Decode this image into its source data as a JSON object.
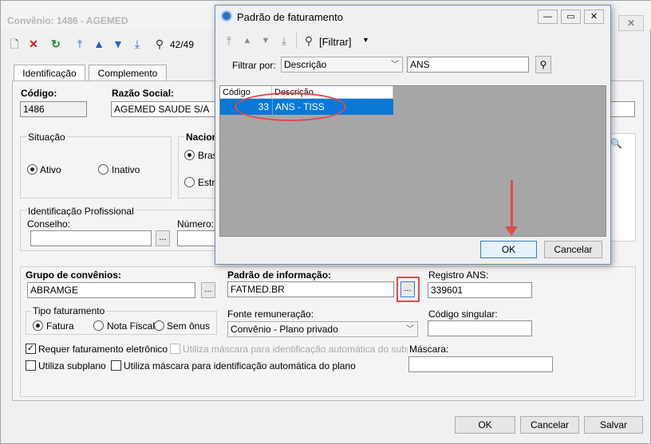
{
  "main_window": {
    "title": "Convênio: 1486 - AGEMED",
    "close_label": "✕",
    "record_counter": "42/49",
    "tabs": [
      "Identificação",
      "Complemento"
    ],
    "codigo": {
      "label": "Código:",
      "value": "1486"
    },
    "razao_social": {
      "label": "Razão Social:",
      "value": "AGEMED SAUDE S/A"
    },
    "situacao": {
      "label": "Situação",
      "options": [
        "Ativo",
        "Inativo"
      ],
      "selected": "Ativo"
    },
    "nacionalidade": {
      "label": "Nacion",
      "options": [
        "Bras",
        "Estra"
      ]
    },
    "id_profissional": {
      "label": "Identificação Profissional",
      "conselho_label": "Conselho:",
      "numero_label": "Número:"
    },
    "grupo_convenios": {
      "label": "Grupo de convênios:",
      "value": "ABRAMGE"
    },
    "padrao_informacao": {
      "label": "Padrão de informação:",
      "value": "FATMED.BR"
    },
    "registro_ans": {
      "label": "Registro ANS:",
      "value": "339601"
    },
    "tipo_faturamento": {
      "label": "Tipo faturamento",
      "options": [
        "Fatura",
        "Nota Fiscal",
        "Sem ônus"
      ],
      "selected": "Fatura"
    },
    "fonte_remuneracao": {
      "label": "Fonte remuneração:",
      "value": "Convênio - Plano privado"
    },
    "codigo_singular": {
      "label": "Código singular:"
    },
    "mascara": {
      "label": "Máscara:"
    },
    "checks": {
      "requer": "Requer faturamento eletrônico",
      "mascara_subplano": "Utiliza máscara para identificação automática do subplano",
      "subplano": "Utiliza subplano",
      "mascara_plano": "Utiliza máscara para identificação automática do plano"
    },
    "ellipsis": "...",
    "buttons": {
      "ok": "OK",
      "cancel": "Cancelar",
      "save": "Salvar"
    }
  },
  "dialog": {
    "title": "Padrão de faturamento",
    "filter_button": "[Filtrar]",
    "filter_by_label": "Filtrar por:",
    "filter_field": "Descrição",
    "filter_value": "ANS",
    "columns": [
      "Código",
      "Descrição"
    ],
    "rows": [
      {
        "codigo": "33",
        "descricao": "ANS - TISS"
      }
    ],
    "buttons": {
      "ok": "OK",
      "cancel": "Cancelar"
    }
  },
  "colors": {
    "selection": "#0a78d7",
    "annotation": "#e04a4a"
  }
}
